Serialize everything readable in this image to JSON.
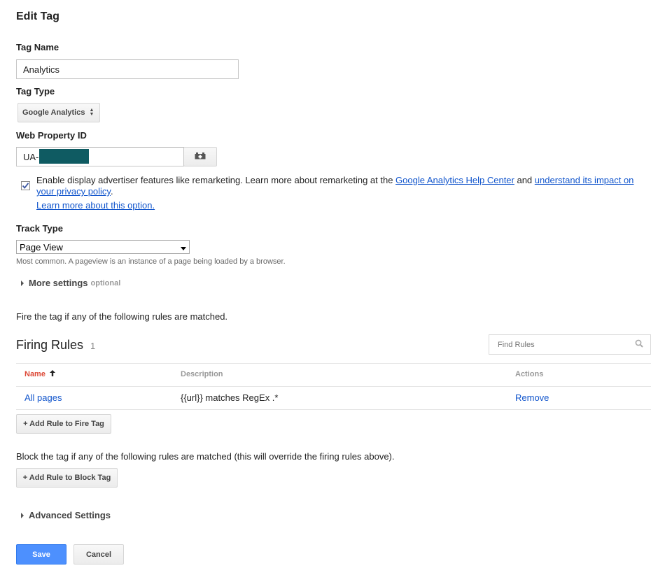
{
  "page_title": "Edit Tag",
  "tag_name": {
    "label": "Tag Name",
    "value": "Analytics"
  },
  "tag_type": {
    "label": "Tag Type",
    "selected": "Google Analytics"
  },
  "web_property": {
    "label": "Web Property ID",
    "value": "UA-"
  },
  "advertiser": {
    "text_before": "Enable display advertiser features like remarketing. Learn more about remarketing at the ",
    "help_center_link": "Google Analytics Help Center",
    "text_and": " and ",
    "impact_link": "understand its impact on your privacy policy",
    "text_period": ".",
    "learn_more_link": "Learn more about this option.",
    "checked": true
  },
  "track_type": {
    "label": "Track Type",
    "selected": "Page View",
    "note": "Most common. A pageview is an instance of a page being loaded by a browser."
  },
  "more_settings": {
    "label": "More settings",
    "optional": "optional"
  },
  "fire_intro": "Fire the tag if any of the following rules are matched.",
  "firing_rules": {
    "title": "Firing Rules",
    "count": "1",
    "search_placeholder": "Find Rules",
    "columns": {
      "name": "Name",
      "description": "Description",
      "actions": "Actions"
    },
    "sort_arrow": "🠕",
    "rows": [
      {
        "name": "All pages",
        "description": "{{url}} matches RegEx .*",
        "action": "Remove"
      }
    ],
    "add_button": "+ Add Rule to Fire Tag"
  },
  "block_intro": "Block the tag if any of the following rules are matched (this will override the firing rules above).",
  "block_button": "+ Add Rule to Block Tag",
  "advanced_settings": "Advanced Settings",
  "buttons": {
    "save": "Save",
    "cancel": "Cancel"
  },
  "colors": {
    "accent_blue": "#4d90fe",
    "link": "#1155cc",
    "sort_red": "#dd4b39",
    "redaction": "#0f5b62"
  }
}
